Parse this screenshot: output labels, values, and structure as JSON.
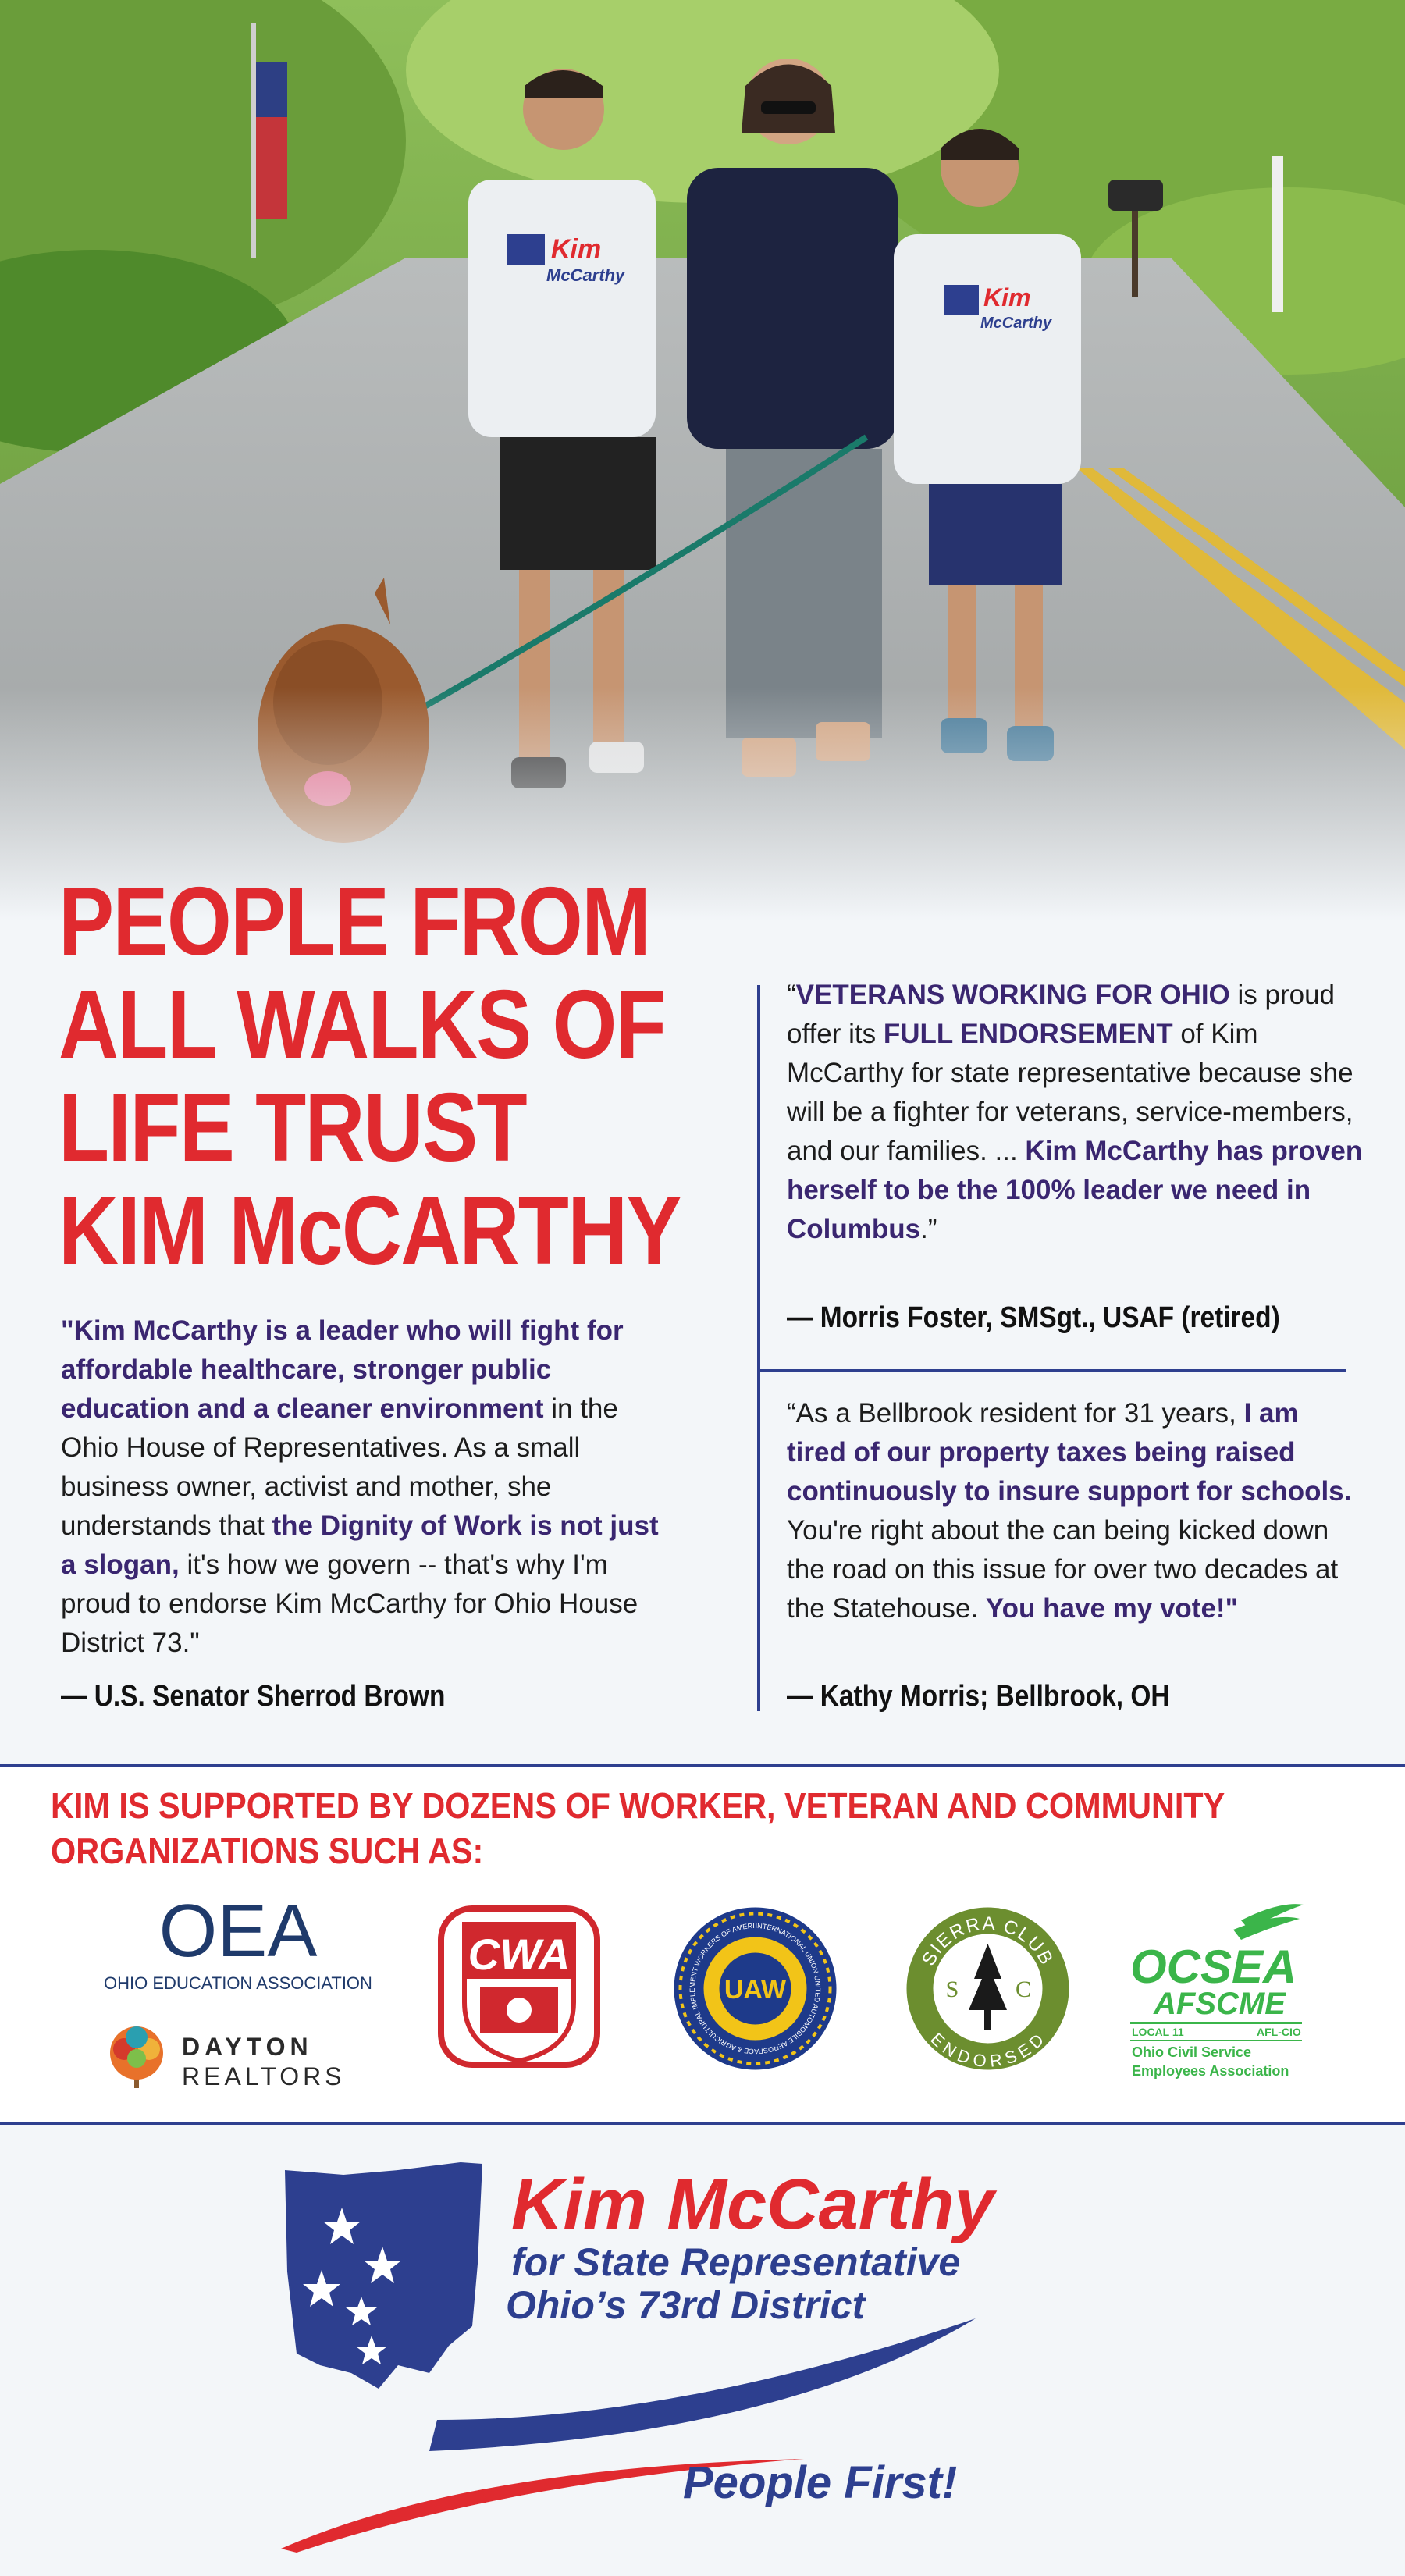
{
  "headline": {
    "lines": [
      "PEOPLE FROM",
      "ALL WALKS OF",
      "LIFE TRUST",
      "KIM McCARTHY"
    ]
  },
  "photo": {
    "shirt_text": [
      "Kim",
      "McCarthy"
    ]
  },
  "quotes": {
    "left": {
      "bold_intro": "\"Kim McCarthy is a leader who will fight for affordable healthcare, stronger public education and a cleaner environment",
      "text_1": " in the Ohio House of Representatives. As a small business owner, activist and mother, she understands that ",
      "bold_2": "the Dignity of Work is not just a slogan,",
      "text_2": " it's how we govern -- that's why I'm proud to endorse Kim McCarthy for Ohio House District 73.\"",
      "attribution": "— U.S. Senator Sherrod Brown"
    },
    "right_1": {
      "open": "“",
      "bold_1": "VETERANS WORKING FOR OHIO",
      "text_1": " is proud offer its ",
      "bold_2": "FULL ENDORSEMENT",
      "text_2": " of Kim McCarthy for state representative because she will be a fighter for veterans, service-members, and our families. ... ",
      "bold_3": "Kim McCarthy has proven herself to be the 100% leader we need in Columbus",
      "close": ".”",
      "attribution": "— Morris Foster, SMSgt., USAF (retired)"
    },
    "right_2": {
      "text_1": "“As a Bellbrook resident for 31 years, ",
      "bold_1": "I am tired of our property taxes being raised continuously to insure support for schools.",
      "text_2": " You're right about the can being kicked down the road on this issue for over two decades at the Statehouse. ",
      "bold_2": "You have my vote!\"",
      "attribution": "— Kathy Morris; Bellbrook, OH"
    }
  },
  "organizations": {
    "heading": "KIM IS SUPPORTED BY DOZENS OF WORKER, VETERAN AND COMMUNITY ORGANIZATIONS SUCH AS:",
    "oea": {
      "abbr": "OEA",
      "name": "OHIO EDUCATION ASSOCIATION"
    },
    "dayton": {
      "line1": "DAYTON",
      "line2": "REALTORS"
    },
    "cwa": {
      "abbr": "CWA"
    },
    "uaw": {
      "abbr": "UAW",
      "ring": "INTERNATIONAL UNION UNITED AUTOMOBILE AEROSPACE & AGRICULTURAL IMPLEMENT WORKERS OF AMERICA"
    },
    "sierra": {
      "top": "SIERRA CLUB",
      "bottom": "ENDORSED",
      "left": "S",
      "right": "C"
    },
    "ocsea": {
      "name": "OCSEA",
      "afscme": "AFSCME",
      "local": "LOCAL 11",
      "aflcio": "AFL-CIO",
      "line1": "Ohio Civil Service",
      "line2": "Employees Association"
    }
  },
  "campaign_logo": {
    "name": "Kim McCarthy",
    "office": "for State Representative",
    "district": "Ohio’s 73rd District",
    "slogan": "People First!"
  },
  "colors": {
    "red": "#e02a2f",
    "navy": "#2e3f8f",
    "purple": "#3a2670",
    "green": "#3bb54a"
  }
}
